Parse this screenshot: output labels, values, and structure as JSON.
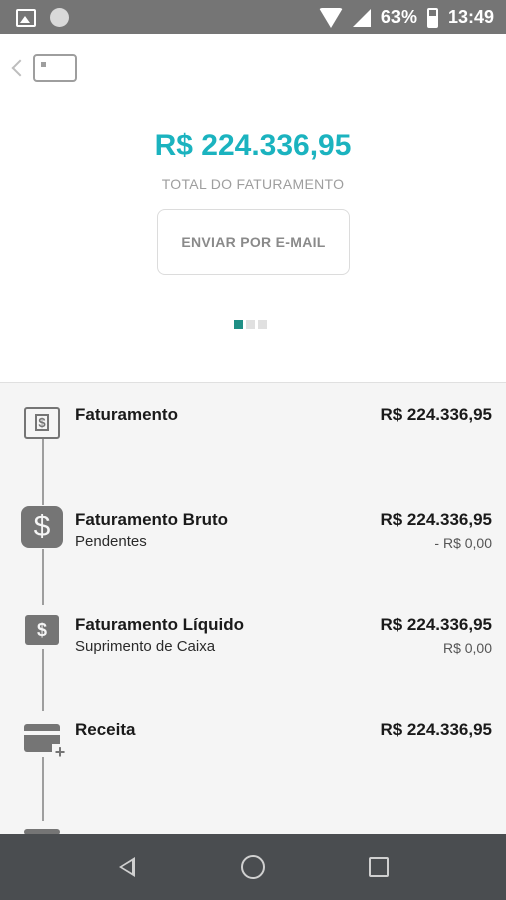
{
  "status_bar": {
    "battery": "63%",
    "time": "13:49"
  },
  "header": {
    "total_amount": "R$ 224.336,95",
    "total_label": "TOTAL DO FATURAMENTO",
    "email_button": "ENVIAR POR E-MAIL",
    "pages": 3,
    "active_page": 1
  },
  "colors": {
    "accent": "#1bb3bf",
    "pager_active": "#1f8f85",
    "icon_gray": "#757575"
  },
  "items": [
    {
      "icon": "dollar-bill-icon",
      "title": "Faturamento",
      "subtitle": "",
      "amount": "R$ 224.336,95",
      "subamount": ""
    },
    {
      "icon": "dollar-sign-icon",
      "title": "Faturamento Bruto",
      "subtitle": "Pendentes",
      "amount": "R$ 224.336,95",
      "subamount": "- R$ 0,00"
    },
    {
      "icon": "dollar-badge-icon",
      "title": "Faturamento Líquido",
      "subtitle": "Suprimento de Caixa",
      "amount": "R$ 224.336,95",
      "subamount": "R$ 0,00"
    },
    {
      "icon": "card-plus-icon",
      "title": "Receita",
      "subtitle": "",
      "amount": "R$ 224.336,95",
      "subamount": ""
    }
  ]
}
